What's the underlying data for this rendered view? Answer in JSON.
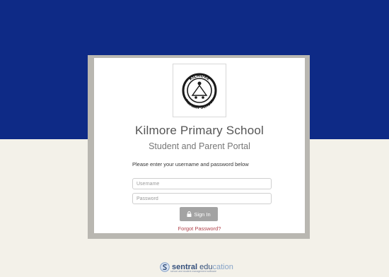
{
  "login": {
    "school_name": "Kilmore Primary School",
    "portal_name": "Student and Parent Portal",
    "instruction": "Please enter your username and password below",
    "username_placeholder": "Username",
    "password_placeholder": "Password",
    "signin_label": "Sign In",
    "forgot_label": "Forgot Password?"
  },
  "crest": {
    "top_text": "KILMORE",
    "bottom_text": "PRIMARY SCHOOL"
  },
  "footer": {
    "brand_part1": "sentral",
    "brand_part2": " edu",
    "brand_part3": "cation",
    "tagline": "school and student management software"
  },
  "colors": {
    "top_band": "#0e2a86",
    "background": "#f3f1e9",
    "signin_button": "#a3a3a3",
    "forgot_link": "#b0414a"
  },
  "icons": {
    "signin": "lock-icon",
    "footer": "sentral-logo-icon"
  }
}
